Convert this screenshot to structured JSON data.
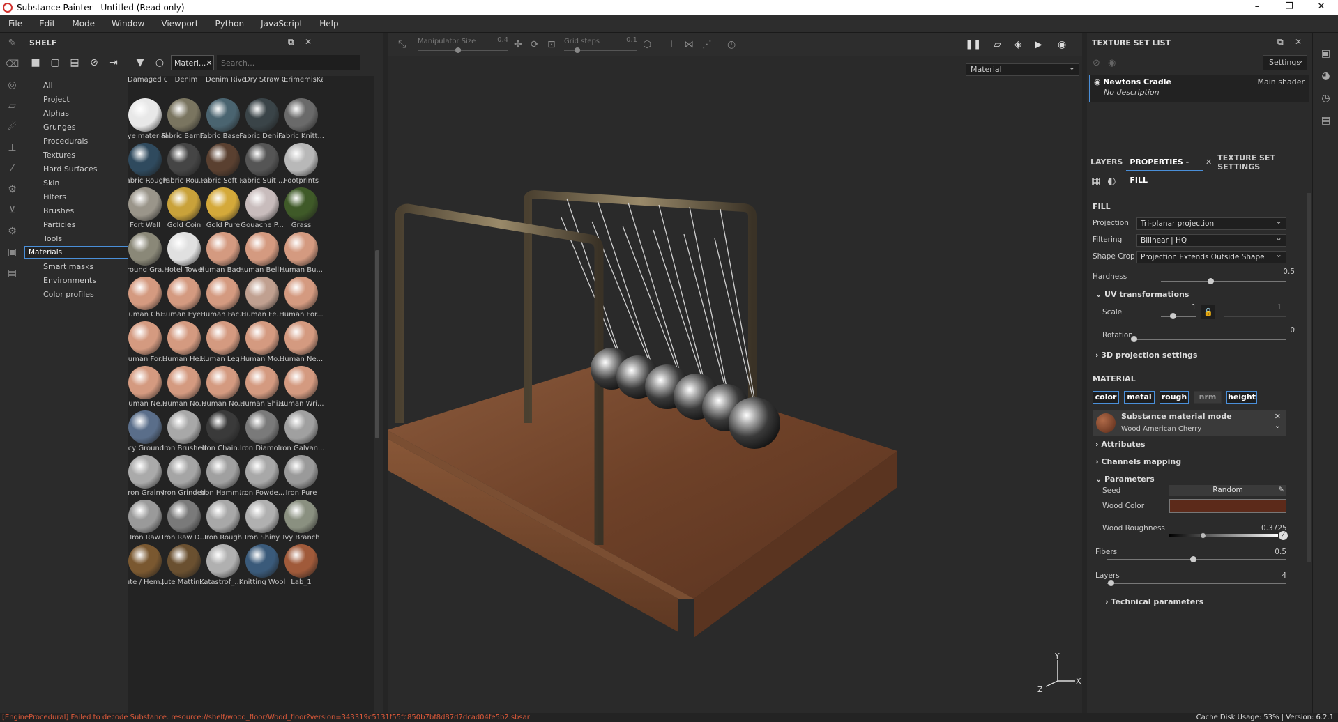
{
  "window": {
    "title": "Substance Painter - Untitled (Read only)",
    "min": "–",
    "max": "❐",
    "close": "✕"
  },
  "menu": [
    "File",
    "Edit",
    "Mode",
    "Window",
    "Viewport",
    "Python",
    "JavaScript",
    "Help"
  ],
  "shelf": {
    "title": "SHELF",
    "filter_chip": "Materi...",
    "search_placeholder": "Search...",
    "categories": [
      "All",
      "Project",
      "Alphas",
      "Grunges",
      "Procedurals",
      "Textures",
      "Hard Surfaces",
      "Skin",
      "Filters",
      "Brushes",
      "Particles",
      "Tools",
      "Materials",
      "Smart materials",
      "Smart masks",
      "Environments",
      "Color profiles"
    ],
    "selected_category": "Materials",
    "top_row_labels": [
      "Damaged C...",
      "Denim",
      "Denim Rivet",
      "Dry Straw G...",
      "ErimemisKar"
    ],
    "materials": [
      {
        "name": "Eye material",
        "color": "#e8e8e8"
      },
      {
        "name": "Fabric Bam...",
        "color": "#7a7560"
      },
      {
        "name": "Fabric Base...",
        "color": "#4a6470"
      },
      {
        "name": "Fabric Deni...",
        "color": "#3a4448"
      },
      {
        "name": "Fabric Knitt...",
        "color": "#6a6a6a"
      },
      {
        "name": "Fabric Rough",
        "color": "#2f4a5e"
      },
      {
        "name": "Fabric Rou...",
        "color": "#454545"
      },
      {
        "name": "Fabric Soft ...",
        "color": "#5a4030"
      },
      {
        "name": "Fabric Suit ...",
        "color": "#555555"
      },
      {
        "name": "Footprints",
        "color": "#b8b8b8"
      },
      {
        "name": "Fort Wall",
        "color": "#9a958a"
      },
      {
        "name": "Gold Coin",
        "color": "#c9a23a"
      },
      {
        "name": "Gold Pure",
        "color": "#d4a93a"
      },
      {
        "name": "Gouache P...",
        "color": "#c8bcbc"
      },
      {
        "name": "Grass",
        "color": "#3f5a28"
      },
      {
        "name": "Ground Gra...",
        "color": "#8a8878"
      },
      {
        "name": "Hotel Towel",
        "color": "#e0e0e0"
      },
      {
        "name": "Human Bac...",
        "color": "#d49a80"
      },
      {
        "name": "Human Bell...",
        "color": "#d49a80"
      },
      {
        "name": "Human Bu...",
        "color": "#d49a80"
      },
      {
        "name": "Human Ch...",
        "color": "#d49a80"
      },
      {
        "name": "Human Eye...",
        "color": "#d49a80"
      },
      {
        "name": "Human Fac...",
        "color": "#d49a80"
      },
      {
        "name": "Human Fe...",
        "color": "#c0a090"
      },
      {
        "name": "Human For...",
        "color": "#d49a80"
      },
      {
        "name": "Human For...",
        "color": "#d49a80"
      },
      {
        "name": "Human He...",
        "color": "#d49a80"
      },
      {
        "name": "Human Leg...",
        "color": "#d49a80"
      },
      {
        "name": "Human Mo...",
        "color": "#d49a80"
      },
      {
        "name": "Human Ne...",
        "color": "#d49a80"
      },
      {
        "name": "Human Ne...",
        "color": "#d49a80"
      },
      {
        "name": "Human No...",
        "color": "#d49a80"
      },
      {
        "name": "Human No...",
        "color": "#d49a80"
      },
      {
        "name": "Human Shi...",
        "color": "#d49a80"
      },
      {
        "name": "Human Wri...",
        "color": "#d49a80"
      },
      {
        "name": "Icy Ground",
        "color": "#5a6e8a"
      },
      {
        "name": "Iron Brushed",
        "color": "#a8a8a8"
      },
      {
        "name": "Iron Chain...",
        "color": "#3a3a3a"
      },
      {
        "name": "Iron Diamo...",
        "color": "#7a7a7a"
      },
      {
        "name": "Iron Galvan...",
        "color": "#a0a0a0"
      },
      {
        "name": "Iron Grainy",
        "color": "#aaaaaa"
      },
      {
        "name": "Iron Grinded",
        "color": "#a5a5a5"
      },
      {
        "name": "Iron Hamm...",
        "color": "#a0a0a0"
      },
      {
        "name": "Iron Powde...",
        "color": "#a8a8a8"
      },
      {
        "name": "Iron Pure",
        "color": "#9a9a9a"
      },
      {
        "name": "Iron Raw",
        "color": "#9a9a9a"
      },
      {
        "name": "Iron Raw D...",
        "color": "#7a7a7a"
      },
      {
        "name": "Iron Rough",
        "color": "#a8a8a8"
      },
      {
        "name": "Iron Shiny",
        "color": "#b0b0b0"
      },
      {
        "name": "Ivy Branch",
        "color": "#8a9080"
      },
      {
        "name": "Jute / Hem...",
        "color": "#7a5830"
      },
      {
        "name": "Jute Mattin...",
        "color": "#6a5030"
      },
      {
        "name": "Katastrof_M...",
        "color": "#b0b0b0"
      },
      {
        "name": "Knitting Wool",
        "color": "#3a5a7a"
      },
      {
        "name": "Lab_1",
        "color": "#a05a3a"
      }
    ]
  },
  "viewport": {
    "manipulator_label": "Manipulator Size",
    "manipulator_value": "0.4",
    "grid_label": "Grid steps",
    "grid_value": "0.1",
    "channel_select": "Material"
  },
  "texture_set_list": {
    "title": "TEXTURE SET LIST",
    "settings": "Settings",
    "item_name": "Newtons Cradle",
    "item_shader": "Main shader",
    "item_desc": "No description"
  },
  "tabs": {
    "layers": "LAYERS",
    "properties": "PROPERTIES - FILL",
    "tss": "TEXTURE SET SETTINGS"
  },
  "fill": {
    "title": "FILL",
    "projection_label": "Projection",
    "projection_value": "Tri-planar projection",
    "filtering_label": "Filtering",
    "filtering_value": "Bilinear | HQ",
    "shapecrop_label": "Shape Crop",
    "shapecrop_value": "Projection Extends Outside Shape",
    "hardness_label": "Hardness",
    "hardness_value": "0.5",
    "uv_label": "UV transformations",
    "scale_label": "Scale",
    "scale_value": "1",
    "scale_value2": "1",
    "rotation_label": "Rotation",
    "rotation_value": "0",
    "proj3d_label": "3D projection settings"
  },
  "material": {
    "title": "MATERIAL",
    "channels": [
      "color",
      "metal",
      "rough",
      "nrm",
      "height"
    ],
    "mode_title": "Substance material mode",
    "mode_sub": "Wood American Cherry",
    "attributes": "Attributes",
    "channels_mapping": "Channels mapping",
    "parameters": "Parameters",
    "seed_label": "Seed",
    "seed_value": "Random",
    "woodcolor_label": "Wood Color",
    "woodcolor": "#5c2a1a",
    "woodrough_label": "Wood Roughness",
    "woodrough_value": "0.3725",
    "fibers_label": "Fibers",
    "fibers_value": "0.5",
    "layers_label": "Layers",
    "layers_value": "4",
    "technical": "Technical parameters"
  },
  "status": {
    "error": "[EngineProcedural] Failed to decode Substance. resource://shelf/wood_floor/Wood_floor?version=343319c5131f55fc850b7bf8d87d7dcad04fe5b2.sbsar",
    "cache": "Cache Disk Usage:   53%  |  Version: 6.2.1"
  },
  "colors": {
    "accent": "#4a8fd9",
    "error": "#e05a3a"
  }
}
